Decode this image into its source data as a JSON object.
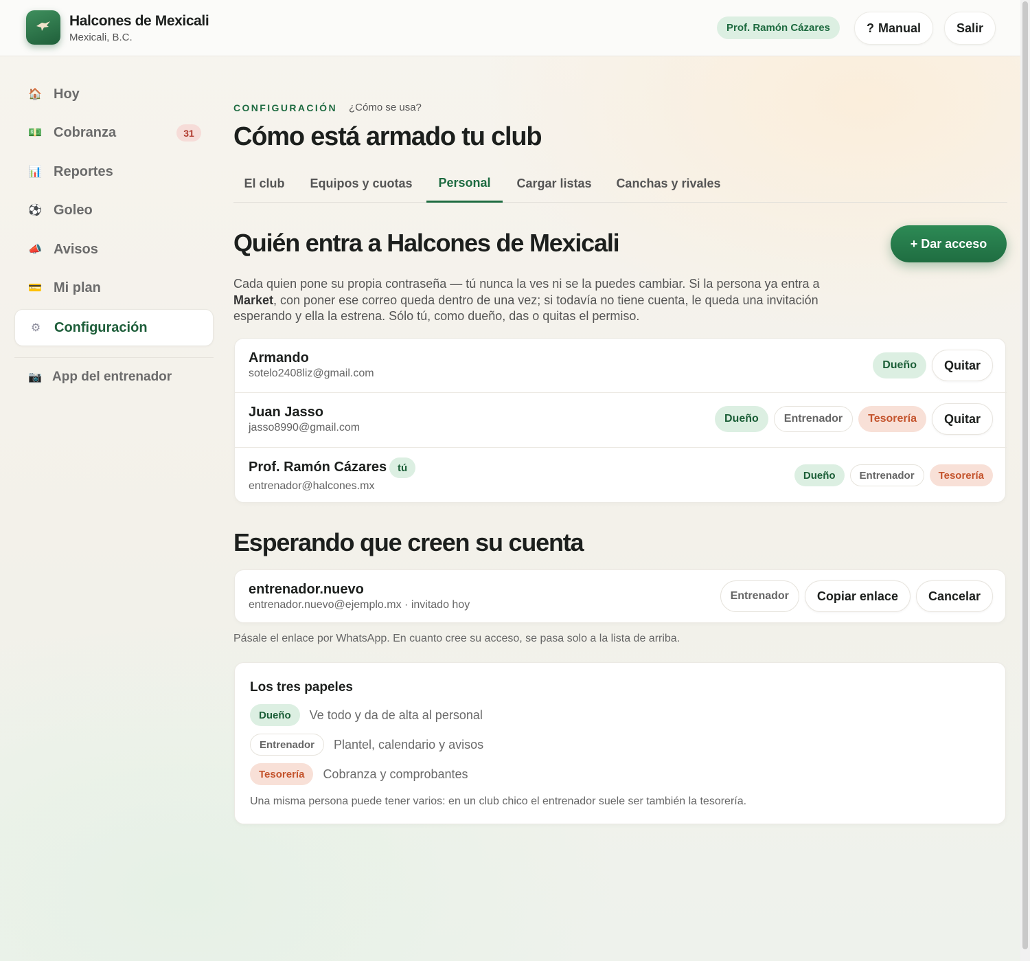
{
  "header": {
    "club_name": "Halcones de Mexicali",
    "club_location": "Mexicali, B.C.",
    "logo_icon": "hawk-icon",
    "user": "Prof. Ramón Cázares",
    "manual_icon": "?",
    "manual_label": "Manual",
    "logout_label": "Salir"
  },
  "sidebar": {
    "items": [
      {
        "label": "Hoy",
        "icon": "🏠"
      },
      {
        "label": "Cobranza",
        "icon": "💵",
        "badge": "31"
      },
      {
        "label": "Reportes",
        "icon": "📊"
      },
      {
        "label": "Goleo",
        "icon": "⚽"
      },
      {
        "label": "Avisos",
        "icon": "📣"
      },
      {
        "label": "Mi plan",
        "icon": "💳"
      },
      {
        "label": "Configuración",
        "icon": "⚙"
      }
    ],
    "coach_app": {
      "label": "App del entrenador",
      "icon": "📷"
    }
  },
  "main": {
    "eyebrow": "CONFIGURACIÓN",
    "howto_link": "¿Cómo se usa?",
    "title": "Cómo está armado tu club",
    "tabs": [
      "El club",
      "Equipos y cuotas",
      "Personal",
      "Cargar listas",
      "Canchas y rivales"
    ],
    "active_tab": "Personal",
    "access": {
      "title": "Quién entra a Halcones de Mexicali",
      "cta": "+ Dar acceso",
      "intro_1": "Cada quien pone su propia contraseña — tú nunca la ves ni se la puedes cambiar. Si la persona ya entra a ",
      "intro_bold": "Market",
      "intro_2": ", con poner ese correo queda dentro de una vez; si todavía no tiene cuenta, le queda una invitación esperando y ella la estrena. Sólo tú, como dueño, das o quitas el permiso.",
      "members": [
        {
          "name": "Armando",
          "email": "sotelo2408liz@gmail.com",
          "roles": [
            "Dueño"
          ],
          "remove": "Quitar"
        },
        {
          "name": "Juan Jasso",
          "email": "jasso8990@gmail.com",
          "roles": [
            "Dueño",
            "Entrenador",
            "Tesorería"
          ],
          "remove": "Quitar"
        },
        {
          "name": "Prof. Ramón Cázares",
          "you": "tú",
          "email": "entrenador@halcones.mx",
          "roles": [
            "Dueño",
            "Entrenador",
            "Tesorería"
          ]
        }
      ]
    },
    "pending": {
      "title": "Esperando que creen su cuenta",
      "invite": {
        "name": "entrenador.nuevo",
        "detail": "entrenador.nuevo@ejemplo.mx · invitado hoy",
        "role": "Entrenador",
        "copy_label": "Copiar enlace",
        "cancel_label": "Cancelar"
      },
      "note": "Pásale el enlace por WhatsApp. En cuanto cree su acceso, se pasa solo a la lista de arriba."
    },
    "roles_box": {
      "title": "Los tres papeles",
      "roles": [
        {
          "name": "Dueño",
          "desc": "Ve todo y da de alta al personal"
        },
        {
          "name": "Entrenador",
          "desc": "Plantel, calendario y avisos"
        },
        {
          "name": "Tesorería",
          "desc": "Cobranza y comprobantes"
        }
      ],
      "footnote": "Una misma persona puede tener varios: en un club chico el entrenador suele ser también la tesorería."
    }
  },
  "colors": {
    "accent": "#1e6b41",
    "owner_bg": "#dcefe2",
    "treasury_bg": "#f8e0d7",
    "treasury_fg": "#c4542d",
    "badge_bg": "#f6dcd8"
  }
}
